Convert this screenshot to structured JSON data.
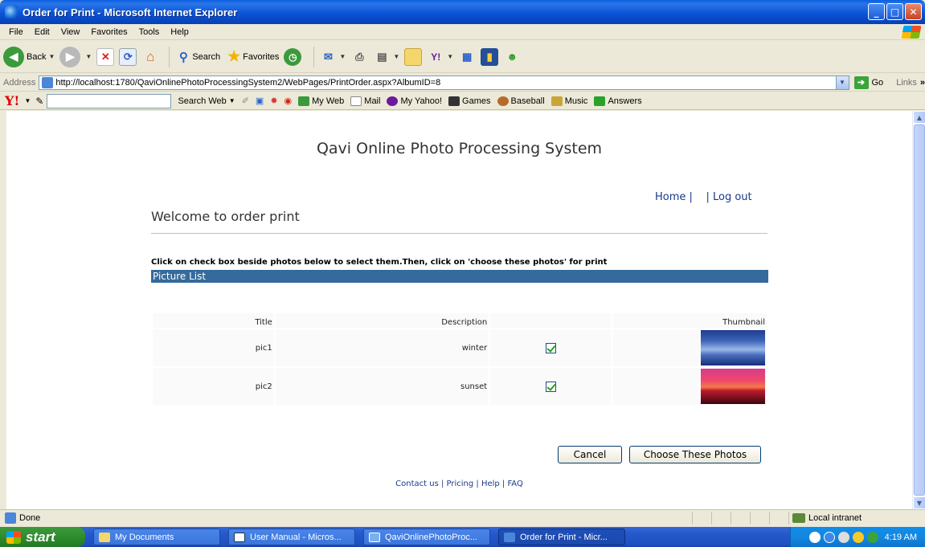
{
  "window": {
    "title": "Order for Print - Microsoft Internet Explorer"
  },
  "menu": [
    "File",
    "Edit",
    "View",
    "Favorites",
    "Tools",
    "Help"
  ],
  "toolbar": {
    "back_label": "Back",
    "search_label": "Search",
    "favorites_label": "Favorites"
  },
  "address": {
    "label": "Address",
    "url": "http://localhost:1780/QaviOnlinePhotoProcessingSystem2/WebPages/PrintOrder.aspx?AlbumID=8",
    "go_label": "Go",
    "links_label": "Links"
  },
  "yahoo": {
    "search_web": "Search Web",
    "items": [
      "My Web",
      "Mail",
      "My Yahoo!",
      "Games",
      "Baseball",
      "Music",
      "Answers"
    ]
  },
  "page": {
    "site_title": "Qavi Online Photo Processing System",
    "nav_home": "Home |",
    "nav_sep": "|",
    "nav_logout": "Log out",
    "welcome": "Welcome to order print",
    "instruction": "Click on check box beside photos below to select them.Then, click on 'choose these photos' for print",
    "list_header": "Picture List",
    "columns": {
      "title": "Title",
      "description": "Description",
      "thumbnail": "Thumbnail"
    },
    "rows": [
      {
        "title": "pic1",
        "description": "winter",
        "checked": true,
        "thumbnail": "winter-photo"
      },
      {
        "title": "pic2",
        "description": "sunset",
        "checked": true,
        "thumbnail": "sunset-photo"
      }
    ],
    "cancel_label": "Cancel",
    "choose_label": "Choose These Photos",
    "footer": "Contact us | Pricing | Help | FAQ"
  },
  "status": {
    "text": "Done",
    "zone": "Local intranet"
  },
  "taskbar": {
    "start": "start",
    "tasks": [
      "My Documents",
      "User Manual - Micros...",
      "QaviOnlinePhotoProc...",
      "Order for Print - Micr..."
    ],
    "clock": "4:19 AM"
  }
}
